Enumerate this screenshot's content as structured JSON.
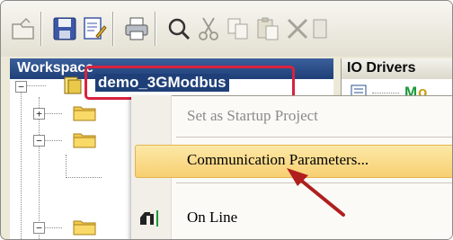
{
  "toolbar": {
    "icons": [
      "open-icon",
      "save-icon",
      "edit-icon",
      "print-icon",
      "find-icon",
      "cut-icon",
      "copy-icon",
      "paste-icon",
      "delete-icon"
    ]
  },
  "workspace": {
    "title": "Workspace",
    "project_name": "demo_3GModbus"
  },
  "io_drivers": {
    "title": "IO Drivers"
  },
  "context_menu": {
    "items": [
      {
        "label": "Set as Startup Project",
        "enabled": false
      },
      {
        "label": "Communication Parameters...",
        "enabled": true,
        "highlighted": true
      },
      {
        "label": "On Line",
        "enabled": true
      }
    ]
  },
  "colors": {
    "highlight_border": "#d8233f",
    "arrow": "#b01e1e",
    "workspace_header": "#1f3f78",
    "menu_hover": "#f7cf72"
  }
}
